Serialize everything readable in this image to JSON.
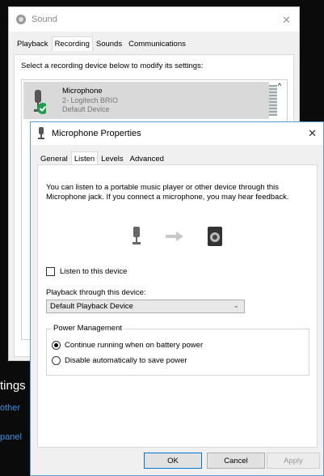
{
  "background": {
    "heading_fragment": "tings",
    "link1_fragment": "other",
    "link2_fragment": "panel"
  },
  "sound_dialog": {
    "title": "Sound",
    "tabs": [
      "Playback",
      "Recording",
      "Sounds",
      "Communications"
    ],
    "active_tab": "Recording",
    "instruction": "Select a recording device below to modify its settings:",
    "selected_device": {
      "name": "Microphone",
      "detail": "2- Logitech BRIO",
      "status": "Default Device"
    }
  },
  "properties_dialog": {
    "title": "Microphone Properties",
    "tabs": [
      "General",
      "Listen",
      "Levels",
      "Advanced"
    ],
    "active_tab": "Listen",
    "description": "You can listen to a portable music player or other device through this Microphone jack.  If you connect a microphone, you may hear feedback.",
    "listen_checkbox": {
      "label": "Listen to this device",
      "checked": false
    },
    "playback_label": "Playback through this device:",
    "playback_selected": "Default Playback Device",
    "power": {
      "legend": "Power Management",
      "options": [
        {
          "label": "Continue running when on battery power",
          "selected": true
        },
        {
          "label": "Disable automatically to save power",
          "selected": false
        }
      ]
    },
    "buttons": {
      "ok": "OK",
      "cancel": "Cancel",
      "apply": "Apply"
    }
  }
}
